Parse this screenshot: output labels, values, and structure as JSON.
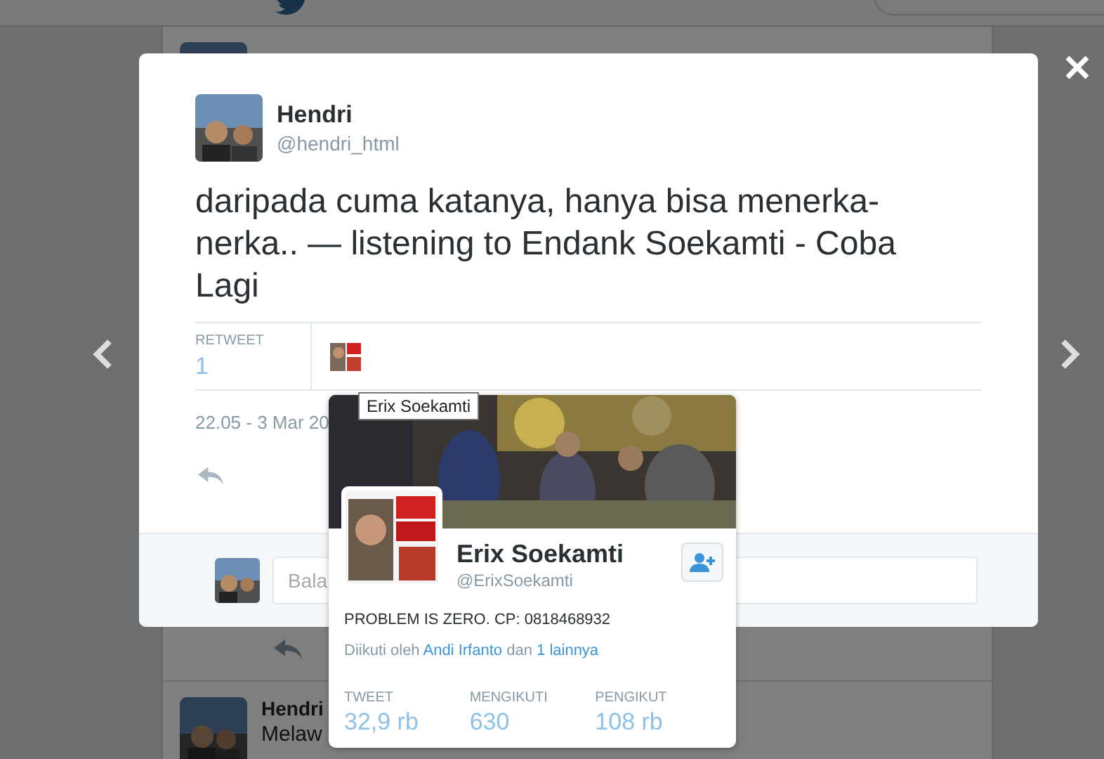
{
  "timeline": [
    {
      "name": "Hendri",
      "text": "Melaw"
    }
  ],
  "modal": {
    "author": {
      "name": "Hendri",
      "handle": "@hendri_html"
    },
    "text": "daripada cuma katanya, hanya bisa menerka-nerka.. — listening to Endank Soekamti - Coba Lagi",
    "stats": [
      {
        "label": "RETWEET",
        "value": "1"
      }
    ],
    "timestamp": "22.05 - 3 Mar 20",
    "reply": {
      "placeholder": "Bala"
    }
  },
  "tooltip": "Erix Soekamti",
  "profile_card": {
    "name": "Erix Soekamti",
    "handle": "@ErixSoekamti",
    "bio": "PROBLEM IS ZERO. CP: 0818468932",
    "followed_by": [
      {
        "text": "Diikuti oleh",
        "link": false
      },
      {
        "text": "Andi Irfanto",
        "link": true
      },
      {
        "text": "dan",
        "link": false
      },
      {
        "text": "1 lainnya",
        "link": true
      }
    ],
    "stats": [
      {
        "label": "TWEET",
        "value": "32,9 rb"
      },
      {
        "label": "MENGIKUTI",
        "value": "630"
      },
      {
        "label": "PENGIKUT",
        "value": "108 rb"
      }
    ]
  }
}
